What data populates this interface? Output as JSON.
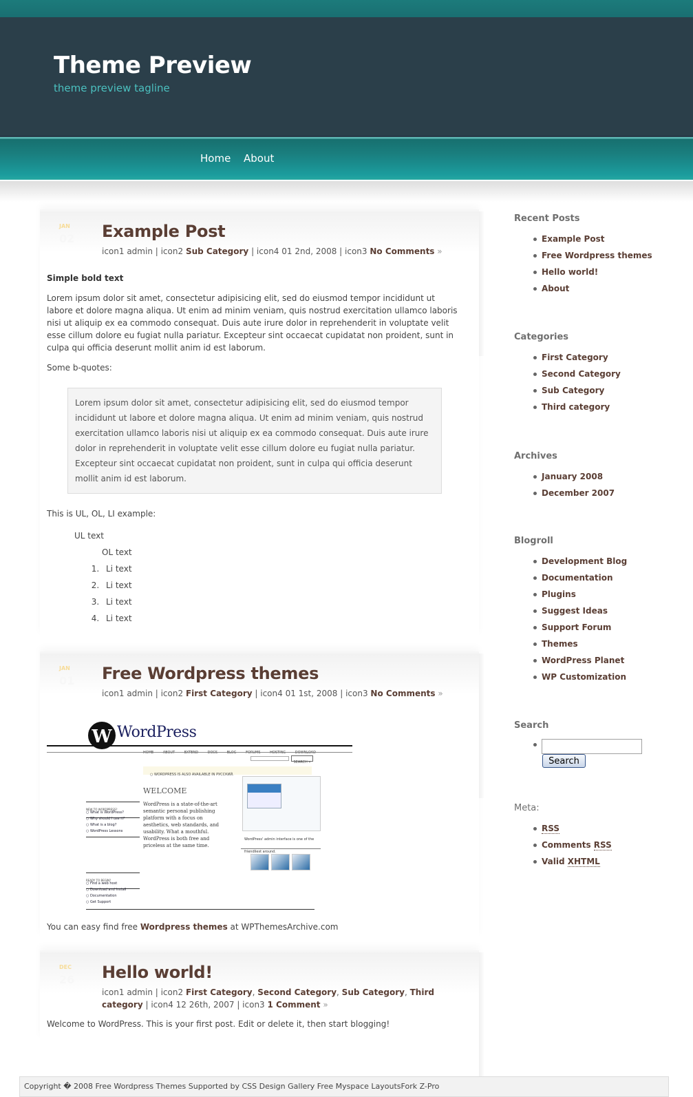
{
  "header": {
    "title": "Theme Preview",
    "tagline": "theme preview tagline"
  },
  "nav": {
    "items": [
      {
        "label": "Home"
      },
      {
        "label": "About"
      }
    ]
  },
  "posts": [
    {
      "date_month": "JAN",
      "date_day": "02",
      "title": "Example Post",
      "meta": {
        "author_prefix": "icon1 admin | icon2 ",
        "categories": [
          "Sub Category"
        ],
        "date_text": " | icon4 01 2nd, 2008 | icon3 ",
        "comments": "No Comments",
        "comments_suffix": " »"
      },
      "body": {
        "bold_text": "Simple bold text",
        "paragraph": "Lorem ipsum dolor sit amet, consectetur adipisicing elit, sed do eiusmod tempor incididunt ut labore et dolore magna aliqua. Ut enim ad minim veniam, quis nostrud exercitation ullamco laboris nisi ut aliquip ex ea commodo consequat. Duis aute irure dolor in reprehenderit in voluptate velit esse cillum dolore eu fugiat nulla pariatur. Excepteur sint occaecat cupidatat non proident, sunt in culpa qui officia deserunt mollit anim id est laborum.",
        "bquote_intro": "Some b-quotes:",
        "blockquote": "Lorem ipsum dolor sit amet, consectetur adipisicing elit, sed do eiusmod tempor incididunt ut labore et dolore magna aliqua. Ut enim ad minim veniam, quis nostrud exercitation ullamco laboris nisi ut aliquip ex ea commodo consequat. Duis aute irure dolor in reprehenderit in voluptate velit esse cillum dolore eu fugiat nulla pariatur. Excepteur sint occaecat cupidatat non proident, sunt in culpa qui officia deserunt mollit anim id est laborum.",
        "list_intro": "This is UL, OL, LI example:",
        "ul_text": "UL text",
        "ol_text": "OL text",
        "li_items": [
          "Li text",
          "Li text",
          "Li text",
          "Li text"
        ]
      }
    },
    {
      "date_month": "JAN",
      "date_day": "01",
      "title": "Free Wordpress themes",
      "meta": {
        "author_prefix": "icon1 admin | icon2 ",
        "categories": [
          "First Category"
        ],
        "date_text": " | icon4 01 1st, 2008 | icon3 ",
        "comments": "No Comments",
        "comments_suffix": " »"
      },
      "body": {
        "screenshot": {
          "logo_text": "WordPress",
          "nav_links": "HOME ABOUT EXTEND DOCS BLOG FORUMS HOSTING DOWNLOAD",
          "search_btn": "SEARCH »",
          "lang_notice": "○ WORDPRESS IS ALSO AVAILABLE IN РУССКИЙ.",
          "welcome": "WELCOME",
          "paragraph": "WordPress is a state-of-the-art semantic personal publishing platform with a focus on aesthetics, web standards, and usability. What a mouthful. WordPress is both free and priceless at the same time.",
          "new_title": "NEW TO WORDPRESS?",
          "new_links": [
            "○ What is WordPress?",
            "○ Why should I use it?",
            "○ What is a blog?",
            "○ WordPress Lessons"
          ],
          "ready_title": "READY TO BEGIN?",
          "ready_links": [
            "○ Find a web host",
            "○ Download and Install",
            "○ Documentation",
            "○ Get Support"
          ],
          "caption": "WordPress' admin interface is one of the friendliest around."
        },
        "text_before": "You can easy find free ",
        "link": "Wordpress themes",
        "text_after": " at WPThemesArchive.com"
      }
    },
    {
      "date_month": "DEC",
      "date_day": "26",
      "title": "Hello world!",
      "meta": {
        "author_prefix": "icon1 admin | icon2 ",
        "categories": [
          "First Category",
          "Second Category",
          "Sub Category",
          "Third category"
        ],
        "date_text": " | icon4 12 26th, 2007 | icon3 ",
        "comments": "1 Comment",
        "comments_suffix": " »"
      },
      "body": {
        "paragraph": "Welcome to WordPress. This is your first post. Edit or delete it, then start blogging!"
      }
    }
  ],
  "sidebar": {
    "recent_posts": {
      "title": "Recent Posts",
      "items": [
        "Example Post",
        "Free Wordpress themes",
        "Hello world!",
        "About"
      ]
    },
    "categories": {
      "title": "Categories",
      "items": [
        "First Category",
        "Second Category",
        "Sub Category",
        "Third category"
      ]
    },
    "archives": {
      "title": "Archives",
      "items": [
        "January 2008",
        "December 2007"
      ]
    },
    "blogroll": {
      "title": "Blogroll",
      "items": [
        "Development Blog",
        "Documentation",
        "Plugins",
        "Suggest Ideas",
        "Support Forum",
        "Themes",
        "WordPress Planet",
        "WP Customization"
      ]
    },
    "search": {
      "title": "Search",
      "input_value": "",
      "button_label": "Search"
    },
    "meta": {
      "title": "Meta:",
      "rss": "RSS",
      "comments_prefix": "Comments ",
      "comments_rss": "RSS",
      "valid_prefix": "Valid ",
      "xhtml": "XHTML"
    }
  },
  "footer": {
    "text": "Copyright � 2008 Free Wordpress Themes Supported by CSS Design Gallery Free Myspace LayoutsFork Z-Pro"
  }
}
